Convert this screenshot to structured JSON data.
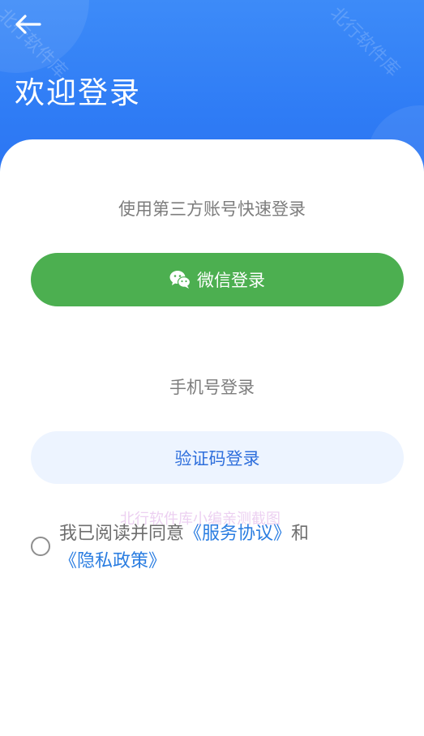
{
  "header": {
    "title": "欢迎登录",
    "back_icon": "arrow-left-icon",
    "watermark": "北行软件库"
  },
  "third_party": {
    "label": "使用第三方账号快速登录",
    "wechat_button_label": "微信登录",
    "wechat_icon": "wechat-icon"
  },
  "phone": {
    "label": "手机号登录",
    "code_button_label": "验证码登录"
  },
  "watermark_center": "北行软件库小编亲测截图",
  "agreement": {
    "prefix": "我已阅读并同意",
    "service_link": "《服务协议》",
    "conjunction": "和",
    "privacy_link": "《隐私政策》"
  },
  "colors": {
    "header": "#2f7cf5",
    "wechat_green": "#4caf50",
    "code_button_bg": "#edf4ff",
    "code_button_text": "#2f6fdc",
    "link": "#2a7de1"
  }
}
